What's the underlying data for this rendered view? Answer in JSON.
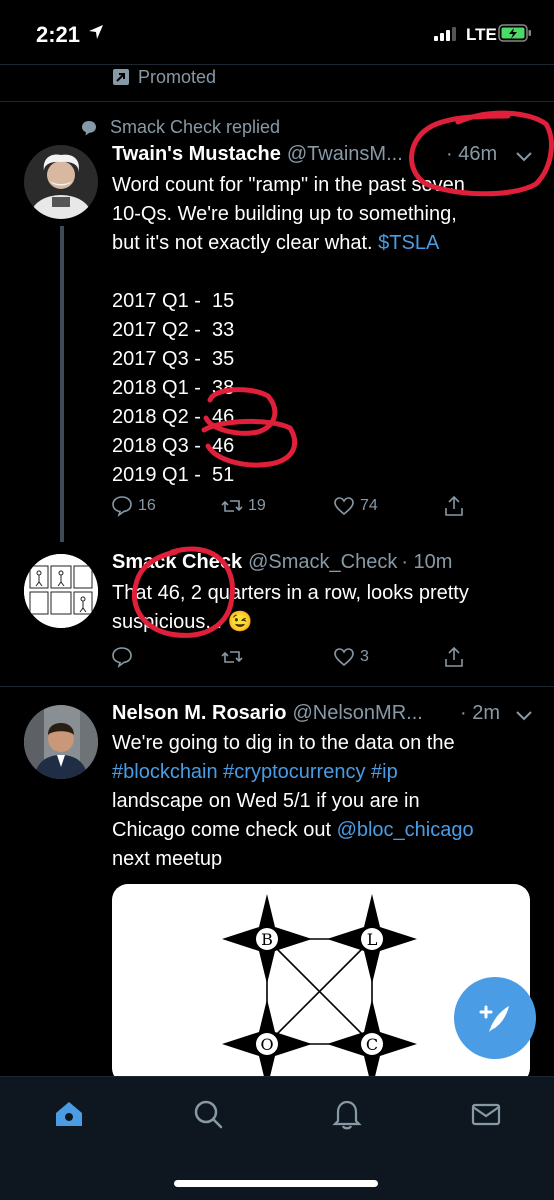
{
  "status_bar": {
    "time": "2:21",
    "network": "LTE"
  },
  "promoted": {
    "label": "Promoted"
  },
  "tweet1": {
    "social_context": "Smack Check replied",
    "name": "Twain's Mustache",
    "handle": "@TwainsM...",
    "time": "· 46m",
    "text_line1": "Word count for \"ramp\" in the past seven",
    "text_line2_pre": "10-Qs. We're building up to something,",
    "text_line3_pre": "but it's not exactly clear what. ",
    "cashtag": "$TSLA",
    "counts": [
      "2017 Q1 -  15",
      "2017 Q2 -  33",
      "2017 Q3 -  35",
      "2018 Q1 -  38",
      "2018 Q2 -  46",
      "2018 Q3 -  46",
      "2019 Q1 -  51"
    ],
    "replies": "16",
    "retweets": "19",
    "likes": "74"
  },
  "tweet2": {
    "name": "Smack Check",
    "handle": "@Smack_Check",
    "time": "· 10m",
    "text_line1": "That 46, 2 quarters in a row, looks pretty",
    "text_line2": "suspicious... ",
    "emoji": "😉",
    "likes": "3"
  },
  "tweet3": {
    "name": "Nelson M. Rosario",
    "handle": "@NelsonMR...",
    "time": "· 2m",
    "text_line1": "We're going to dig in to the data on the",
    "hashtags": "#blockchain #cryptocurrency #ip",
    "text_line3": "landscape on Wed 5/1 if you are in",
    "text_line4_pre": "Chicago come check out ",
    "mention": "@bloc_chicago",
    "text_line5": "next meetup",
    "media_labels": [
      "B",
      "L",
      "O",
      "C"
    ]
  },
  "colors": {
    "accent": "#4a9de5",
    "secondary_text": "#8899a6",
    "annotation": "#e0203a",
    "battery": "#4cd964"
  }
}
